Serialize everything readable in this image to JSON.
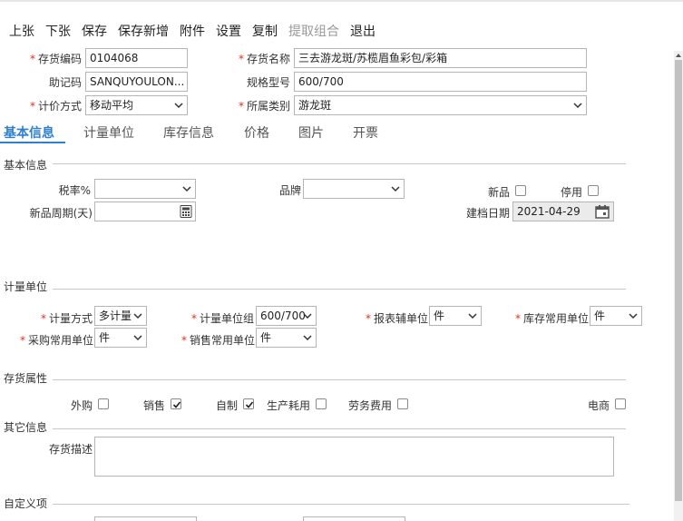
{
  "toolbar": {
    "prev": "上张",
    "next": "下张",
    "save": "保存",
    "save_new": "保存新增",
    "attach": "附件",
    "settings": "设置",
    "copy": "复制",
    "extract": "提取组合",
    "exit": "退出"
  },
  "header": {
    "req_mark": "*",
    "code_label": "存货编码",
    "code_value": "0104068",
    "name_label": "存货名称",
    "name_value": "三去游龙斑/苏榄眉鱼彩包/彩箱",
    "mnemonic_label": "助记码",
    "mnemonic_value": "SANQUYOULON...",
    "spec_label": "规格型号",
    "spec_value": "600/700",
    "pricing_label": "计价方式",
    "pricing_value": "移动平均",
    "category_label": "所属类别",
    "category_value": "游龙斑"
  },
  "tabs": {
    "basic": "基本信息",
    "unit": "计量单位",
    "stock": "库存信息",
    "price": "价格",
    "image": "图片",
    "invoice": "开票"
  },
  "basic": {
    "section": "基本信息",
    "tax_label": "税率%",
    "tax_value": "",
    "brand_label": "品牌",
    "brand_value": "",
    "new_label": "新品",
    "disabled_label": "停用",
    "cycle_label": "新品周期(天)",
    "cycle_value": "",
    "date_label": "建档日期",
    "date_value": "2021-04-29"
  },
  "unit": {
    "section": "计量单位",
    "method_label": "计量方式",
    "method_value": "多计量",
    "group_label": "计量单位组",
    "group_value": "600/700",
    "report_label": "报表辅单位",
    "report_value": "件",
    "stock_label": "库存常用单位",
    "stock_value": "件",
    "purchase_label": "采购常用单位",
    "purchase_value": "件",
    "sales_label": "销售常用单位",
    "sales_value": "件"
  },
  "attrs": {
    "section": "存货属性",
    "outsource": "外购",
    "sales": "销售",
    "selfmade": "自制",
    "consume": "生产耗用",
    "service": "劳务费用",
    "ecommerce": "电商",
    "sales_checked": true,
    "selfmade_checked": true
  },
  "other": {
    "section": "其它信息",
    "desc_label": "存货描述",
    "desc_value": ""
  },
  "custom": {
    "section": "自定义项"
  },
  "colors": {
    "accent": "#2f7fd0",
    "required": "#e0301e",
    "border": "#b5b5b5"
  }
}
